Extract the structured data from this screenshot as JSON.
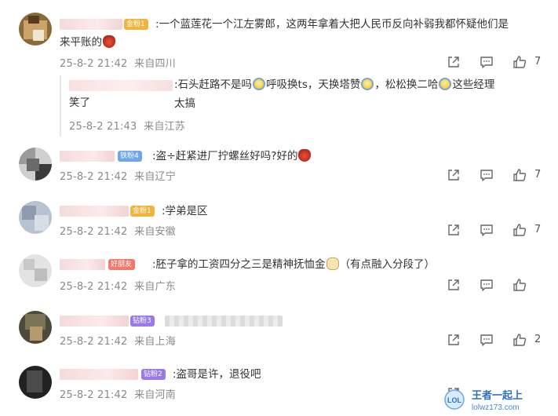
{
  "comments": [
    {
      "badge": "金粉1",
      "text_line1": ":一个蓝莲花一个江左雾郎，这两年拿着大把人民币反向补弱我都怀疑他们是",
      "text_line2": "来平账的",
      "time": "25-8-2 21:42",
      "location": "来自四川",
      "likes": "7"
    },
    {
      "badge": "铁粉4",
      "text": ":盗",
      "text_after": "赶紧进厂拧螺丝好吗?好的",
      "time": "25-8-2 21:42",
      "location": "来自辽宁",
      "likes": "7"
    },
    {
      "badge": "金粉1",
      "text": ":学弟是区",
      "time": "25-8-2 21:42",
      "location": "来自安徽",
      "likes": "7"
    },
    {
      "badge": "好朋友",
      "text": ":胚子拿的工资四分之三是精神抚恤金",
      "text_after": "（有点融入分段了）",
      "time": "25-8-2 21:42",
      "location": "来自广东",
      "likes": ""
    },
    {
      "badge": "钻粉3",
      "text": "",
      "time": "25-8-2 21:42",
      "location": "来自上海",
      "likes": "2"
    },
    {
      "badge": "钻粉2",
      "text": ":盗哥是许，退役吧",
      "time": "25-8-2 21:42",
      "location": "来自河南",
      "likes": ""
    }
  ],
  "reply": {
    "text_a": ":石头赶路不是吗",
    "text_b": "呼吸换ts，天换塔赞",
    "text_c": "，松松换二哈",
    "text_d": "这些经理太搞",
    "text_line2": "笑了",
    "time": "25-8-2 21:43",
    "location": "来自江苏"
  },
  "watermark": {
    "logo": "LOL",
    "brand": "王者一起上",
    "url": "lolwz173.com"
  },
  "icons": [
    "share-icon",
    "comment-icon",
    "like-icon"
  ],
  "colors": {
    "meta": "#8a8a8a",
    "gold_badge": "#f0b43c",
    "iron_badge": "#6fa6e8",
    "friend_badge": "#f07a6a",
    "diamond_badge": "#9a7ae6"
  }
}
